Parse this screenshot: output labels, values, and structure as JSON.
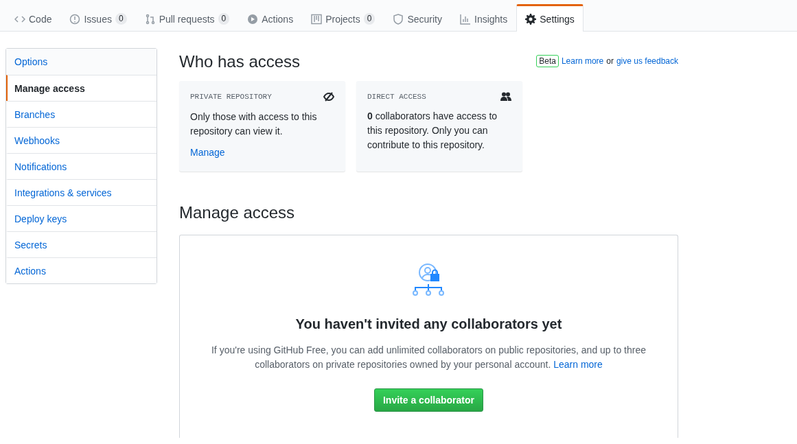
{
  "tabs": [
    {
      "label": "Code",
      "selected": false
    },
    {
      "label": "Issues",
      "count": "0",
      "selected": false
    },
    {
      "label": "Pull requests",
      "count": "0",
      "selected": false
    },
    {
      "label": "Actions",
      "selected": false
    },
    {
      "label": "Projects",
      "count": "0",
      "selected": false
    },
    {
      "label": "Security",
      "selected": false
    },
    {
      "label": "Insights",
      "selected": false
    },
    {
      "label": "Settings",
      "selected": true
    }
  ],
  "sidebar": {
    "items": [
      {
        "label": "Options",
        "selected": false
      },
      {
        "label": "Manage access",
        "selected": true
      },
      {
        "label": "Branches",
        "selected": false
      },
      {
        "label": "Webhooks",
        "selected": false
      },
      {
        "label": "Notifications",
        "selected": false
      },
      {
        "label": "Integrations & services",
        "selected": false
      },
      {
        "label": "Deploy keys",
        "selected": false
      },
      {
        "label": "Secrets",
        "selected": false
      },
      {
        "label": "Actions",
        "selected": false
      }
    ]
  },
  "who_has_access": {
    "title": "Who has access",
    "badge": "Beta",
    "note": [
      {
        "kind": "link",
        "text": "Learn more"
      },
      {
        "kind": "text",
        "text": "or"
      },
      {
        "kind": "link",
        "text": "give us feedback"
      }
    ],
    "cards": [
      {
        "kind": "private",
        "title": "PRIVATE REPOSITORY",
        "body": "Only those with access to this repository can view it.",
        "link": "Manage"
      },
      {
        "kind": "direct",
        "title": "DIRECT ACCESS",
        "body": "**0** collaborators have access to this repository. Only you can contribute to this repository."
      }
    ]
  },
  "manage_access": {
    "title": "Manage access",
    "empty_title": "You haven't invited any collaborators yet",
    "empty_text": "If you're using GitHub Free, you can add unlimited collaborators on public repositories, and up to three collaborators on private repositories owned by your personal account.",
    "empty_link": "Learn more",
    "button": "Invite a collaborator"
  }
}
